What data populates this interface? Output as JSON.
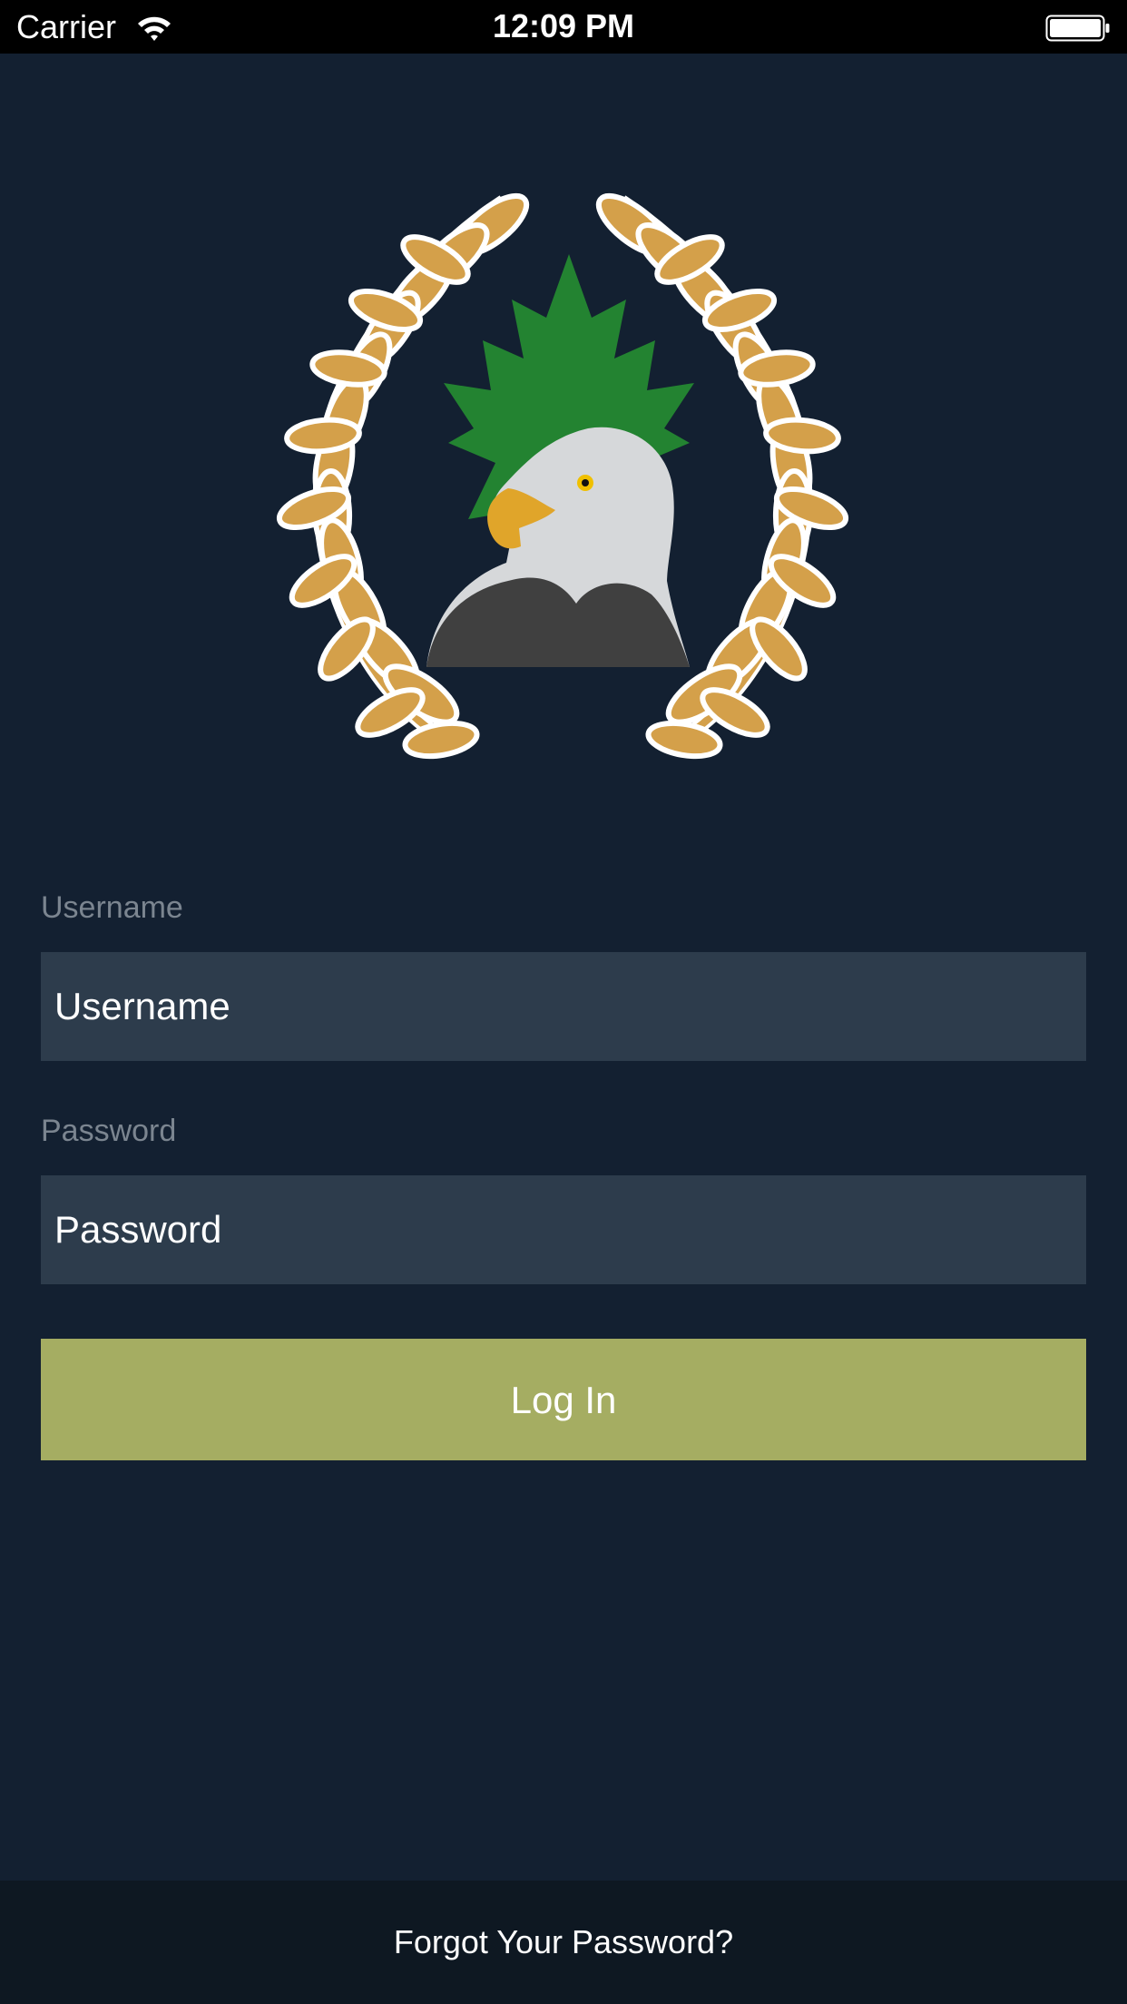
{
  "status_bar": {
    "carrier": "Carrier",
    "time": "12:09 PM"
  },
  "logo": {
    "icon": "eagle-wreath-emblem",
    "colors": {
      "wreath": "#d4a04a",
      "leaf": "#238331"
    }
  },
  "login_form": {
    "username_label": "Username",
    "username_placeholder": "Username",
    "password_label": "Password",
    "password_placeholder": "Password",
    "login_label": "Log In"
  },
  "footer": {
    "forgot_password": "Forgot Your Password?"
  },
  "colors": {
    "background": "#132031",
    "field": "#2d3c4c",
    "button": "#a5ad62",
    "footer": "#0e1822"
  }
}
